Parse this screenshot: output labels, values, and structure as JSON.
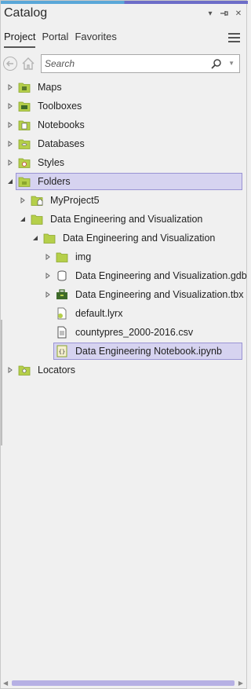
{
  "app": {
    "title": "Catalog",
    "accent_left": "#5aa7d8",
    "accent_right": "#6c6cc8",
    "selection_color": "#d6d3f0"
  },
  "title_controls": {
    "dropdown_glyph": "▾",
    "pin_glyph": "⊣",
    "close_glyph": "✕"
  },
  "tabs": [
    {
      "label": "Project",
      "active": true
    },
    {
      "label": "Portal",
      "active": false
    },
    {
      "label": "Favorites",
      "active": false
    }
  ],
  "search": {
    "placeholder": "Search",
    "value": ""
  },
  "tree": [
    {
      "label": "Maps",
      "icon": "maps-folder-icon",
      "expander": "collapsed",
      "depth": 0
    },
    {
      "label": "Toolboxes",
      "icon": "toolboxes-folder-icon",
      "expander": "collapsed",
      "depth": 0
    },
    {
      "label": "Notebooks",
      "icon": "notebooks-folder-icon",
      "expander": "collapsed",
      "depth": 0
    },
    {
      "label": "Databases",
      "icon": "databases-folder-icon",
      "expander": "collapsed",
      "depth": 0
    },
    {
      "label": "Styles",
      "icon": "styles-folder-icon",
      "expander": "collapsed",
      "depth": 0
    },
    {
      "label": "Folders",
      "icon": "folders-folder-icon",
      "expander": "expanded",
      "depth": 0,
      "selected": true
    },
    {
      "label": "MyProject5",
      "icon": "home-folder-icon",
      "expander": "collapsed",
      "depth": 1
    },
    {
      "label": "Data Engineering and Visualization",
      "icon": "folder-icon",
      "expander": "expanded",
      "depth": 1
    },
    {
      "label": "Data Engineering and Visualization",
      "icon": "folder-icon",
      "expander": "expanded",
      "depth": 2
    },
    {
      "label": "img",
      "icon": "folder-icon",
      "expander": "collapsed",
      "depth": 3
    },
    {
      "label": "Data Engineering and Visualization.gdb",
      "icon": "geodatabase-icon",
      "expander": "collapsed",
      "depth": 3
    },
    {
      "label": "Data Engineering and Visualization.tbx",
      "icon": "toolbox-icon",
      "expander": "collapsed",
      "depth": 3
    },
    {
      "label": "default.lyrx",
      "icon": "layer-file-icon",
      "expander": "none",
      "depth": 3
    },
    {
      "label": "countypres_2000-2016.csv",
      "icon": "csv-file-icon",
      "expander": "none",
      "depth": 3
    },
    {
      "label": "Data Engineering Notebook.ipynb",
      "icon": "notebook-file-icon",
      "expander": "none",
      "depth": 3,
      "selected": true
    },
    {
      "label": "Locators",
      "icon": "locators-folder-icon",
      "expander": "collapsed",
      "depth": 0
    }
  ]
}
